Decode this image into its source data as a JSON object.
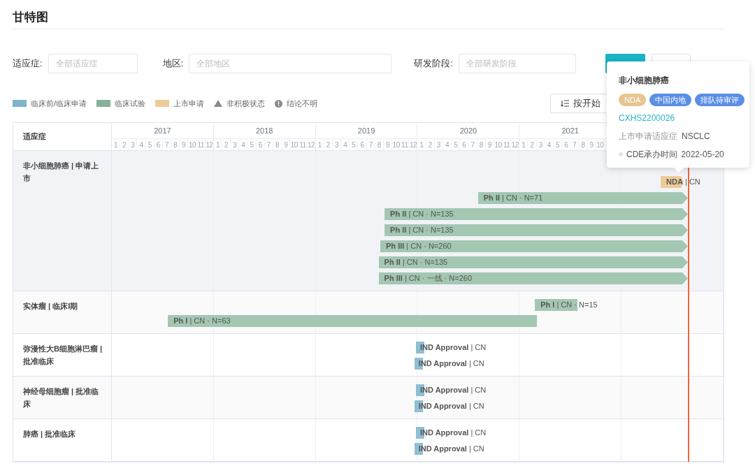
{
  "page": {
    "title": "甘特图"
  },
  "filters": [
    {
      "label": "适应症:",
      "placeholder": "全部适应症"
    },
    {
      "label": "地区:",
      "placeholder": "全部地区"
    },
    {
      "label": "研发阶段:",
      "placeholder": "全部研发阶段"
    }
  ],
  "legend": [
    {
      "kind": "swatch",
      "label": "临床前/临床申请",
      "color": "#7fb3cc"
    },
    {
      "kind": "swatch",
      "label": "临床试验",
      "color": "#86b09a"
    },
    {
      "kind": "swatch",
      "label": "上市申请",
      "color": "#eccb98"
    },
    {
      "kind": "triangle",
      "label": "非积极状态"
    },
    {
      "kind": "alert",
      "label": "结论不明"
    }
  ],
  "sort_button": {
    "label": "按开始"
  },
  "table": {
    "column_header": "适应症",
    "years": [
      {
        "label": "2017",
        "months": [
          "1",
          "2",
          "3",
          "4",
          "5",
          "6",
          "7",
          "8",
          "9",
          "10",
          "11",
          "12"
        ]
      },
      {
        "label": "2018",
        "months": [
          "1",
          "2",
          "3",
          "4",
          "5",
          "6",
          "7",
          "8",
          "9",
          "10",
          "11",
          "12"
        ]
      },
      {
        "label": "2019",
        "months": [
          "1",
          "2",
          "3",
          "4",
          "5",
          "6",
          "7",
          "8",
          "9",
          "10",
          "11",
          "12"
        ]
      },
      {
        "label": "2020",
        "months": [
          "1",
          "2",
          "3",
          "4",
          "5",
          "6",
          "7",
          "8",
          "9",
          "10",
          "11",
          "12"
        ]
      },
      {
        "label": "2021",
        "months": [
          "1",
          "2",
          "3",
          "4",
          "5",
          "6",
          "7",
          "8",
          "9",
          "10"
        ]
      }
    ],
    "rows": [
      {
        "label": "非小细胞肺癌 | 申请上市",
        "selected": true,
        "bars": [
          {
            "kind": "nda",
            "ongoing": true,
            "label": "**NDA** | CN"
          },
          {
            "kind": "trial",
            "ongoing": true,
            "label": "**Ph II** | CN · N=71"
          },
          {
            "kind": "trial",
            "ongoing": true,
            "label": "**Ph II** | CN · N=135"
          },
          {
            "kind": "trial",
            "ongoing": true,
            "label": "**Ph II** | CN · N=135"
          },
          {
            "kind": "trial",
            "ongoing": true,
            "label": "**Ph III** | CN · N=260"
          },
          {
            "kind": "trial",
            "ongoing": true,
            "label": "**Ph II** | CN · N=135"
          },
          {
            "kind": "trial",
            "ongoing": true,
            "label": "**Ph III** | CN · 一线 · N=260"
          }
        ]
      },
      {
        "label": "实体瘤 | 临床I期",
        "selected": false,
        "bars": [
          {
            "kind": "trial",
            "ongoing": false,
            "label": "**Ph I** | CN · N=15"
          },
          {
            "kind": "trial",
            "ongoing": false,
            "label": "**Ph I** | CN · N=63"
          }
        ]
      },
      {
        "label": "弥漫性大B细胞淋巴瘤 | 批准临床",
        "selected": false,
        "bars": [
          {
            "kind": "ind",
            "ongoing": false,
            "label": "**IND Approval** | CN"
          },
          {
            "kind": "ind",
            "ongoing": false,
            "label": "**IND Approval** | CN"
          }
        ]
      },
      {
        "label": "神经母细胞瘤 | 批准临床",
        "selected": false,
        "bars": [
          {
            "kind": "ind",
            "ongoing": false,
            "label": "**IND Approval** | CN"
          },
          {
            "kind": "ind",
            "ongoing": false,
            "label": "**IND Approval** | CN"
          }
        ]
      },
      {
        "label": "肺癌 | 批准临床",
        "selected": false,
        "bars": [
          {
            "kind": "ind",
            "ongoing": false,
            "label": "**IND Approval** | CN"
          },
          {
            "kind": "ind",
            "ongoing": false,
            "label": "**IND Approval** | CN"
          }
        ]
      }
    ]
  },
  "tooltip": {
    "title": "非小细胞肺癌",
    "tags": [
      {
        "label": "NDA",
        "color": "#e6c590"
      },
      {
        "label": "中国内地",
        "color": "#5b8ee6"
      },
      {
        "label": "排队待审评",
        "color": "#5b8ee6"
      }
    ],
    "link": "CXHS2200026",
    "field_label": "上市申请适应症",
    "field_value": "NSCLC",
    "date_label": "CDE承办时间",
    "date_value": "2022-05-20"
  }
}
